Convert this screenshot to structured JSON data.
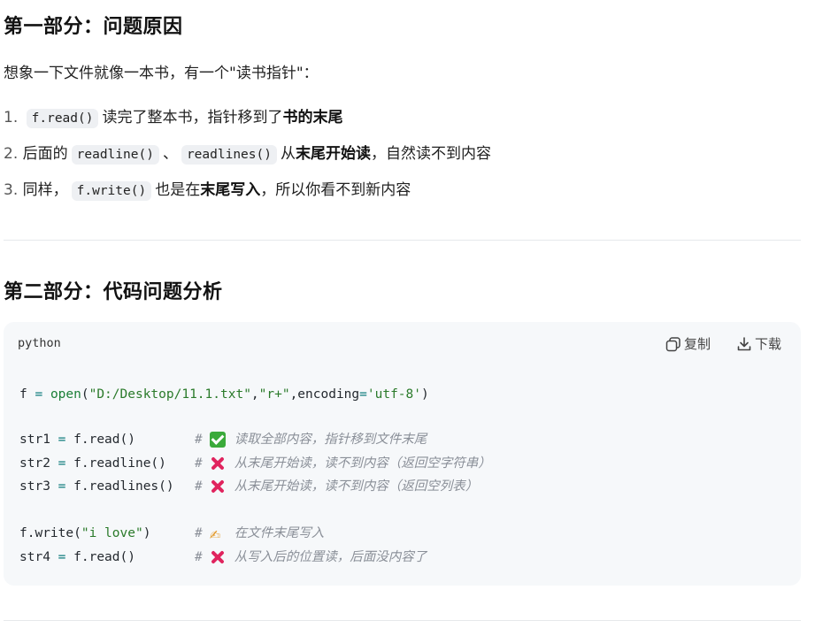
{
  "section1": {
    "heading": "第一部分：问题原因",
    "intro": "想象一下文件就像一本书，有一个\"读书指针\"：",
    "items": [
      {
        "num": "1.",
        "code1": "f.read()",
        "text1": "读完了整本书，指针移到了",
        "bold": "书的末尾"
      },
      {
        "num": "2.",
        "text0": "后面的",
        "code1": "readline()",
        "sep": "、",
        "code2": "readlines()",
        "text1": "从",
        "bold": "末尾开始读",
        "text2": "，自然读不到内容"
      },
      {
        "num": "3.",
        "text0": "同样，",
        "code1": "f.write()",
        "text1": "也是在",
        "bold": "末尾写入",
        "text2": "，所以你看不到新内容"
      }
    ]
  },
  "section2": {
    "heading": "第二部分：代码问题分析"
  },
  "codeblock": {
    "language": "python",
    "copy_label": "复制",
    "download_label": "下载",
    "line1": {
      "a": "f",
      "eq": " = ",
      "fn": "open",
      "p1": "(",
      "s1": "\"D:/Desktop/11.1.txt\"",
      "c": ",",
      "s2": "\"r+\"",
      "kw": ",encoding",
      "eq2": "=",
      "s3": "'utf-8'",
      "p2": ")"
    },
    "lines": [
      {
        "var": "str1",
        "call": "f.read()",
        "icon": "check-icon",
        "comment": "读取全部内容，指针移到文件末尾"
      },
      {
        "var": "str2",
        "call": "f.readline()",
        "icon": "cross-icon",
        "comment": "从末尾开始读，读不到内容（返回空字符串）"
      },
      {
        "var": "str3",
        "call": "f.readlines()",
        "icon": "cross-icon",
        "comment": "从末尾开始读，读不到内容（返回空列表）"
      },
      {
        "var": "",
        "call": "f.write(\"i love\")",
        "icon": "writing-hand-icon",
        "comment": "在文件末尾写入"
      },
      {
        "var": "str4",
        "call": "f.read()",
        "icon": "cross-icon",
        "comment": "从写入后的位置读，后面没内容了"
      }
    ],
    "eq": " = ",
    "hash": "#",
    "write_fn": "f.write(",
    "write_str": "\"i love\"",
    "write_close": ")",
    "write_emoji": "✍"
  },
  "colors": {
    "code_bg": "#f6f8fa",
    "inline_code_bg": "#eef0f3",
    "string_green": "#2a7a2a",
    "comment_gray": "#8a8f98",
    "check_green": "#3aaa3a",
    "cross_red": "#e0245e"
  }
}
